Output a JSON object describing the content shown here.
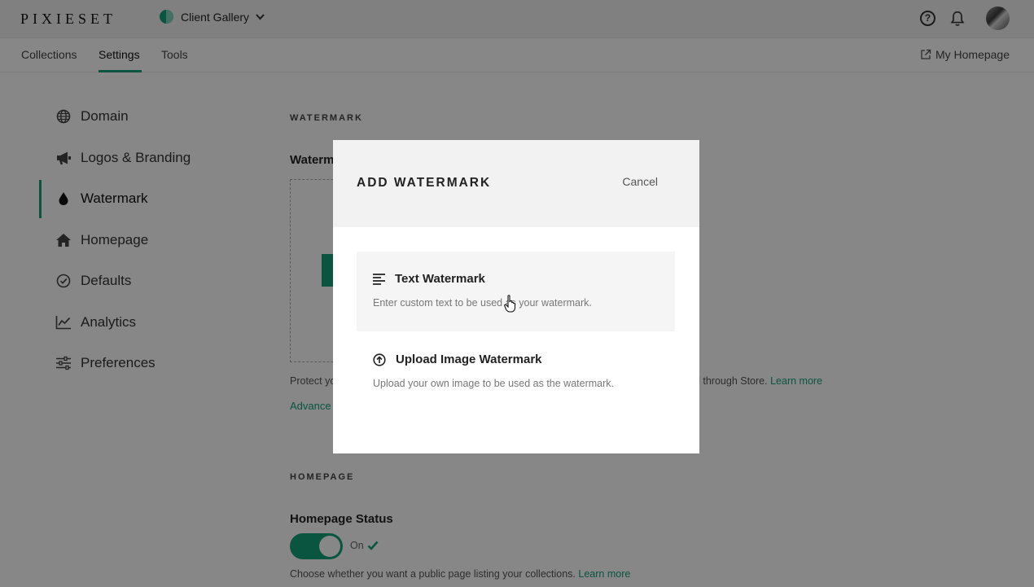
{
  "topbar": {
    "logo": "PIXIESET",
    "gallery_label": "Client Gallery",
    "help_label": "?"
  },
  "subnav": {
    "tabs": [
      {
        "label": "Collections"
      },
      {
        "label": "Settings",
        "active": true
      },
      {
        "label": "Tools"
      }
    ],
    "my_homepage": "My Homepage"
  },
  "sidebar": {
    "items": [
      {
        "label": "Domain",
        "icon": "globe-icon"
      },
      {
        "label": "Logos & Branding",
        "icon": "megaphone-icon"
      },
      {
        "label": "Watermark",
        "icon": "droplet-icon",
        "active": true
      },
      {
        "label": "Homepage",
        "icon": "home-icon"
      },
      {
        "label": "Defaults",
        "icon": "check-circle-icon"
      },
      {
        "label": "Analytics",
        "icon": "line-chart-icon"
      },
      {
        "label": "Preferences",
        "icon": "sliders-icon"
      }
    ]
  },
  "content": {
    "watermark_heading": "WATERMARK",
    "watermark_field_title": "Waterm",
    "protect_text_start": "Protect yo",
    "protect_text_end": "ed through Store.",
    "learn_more": "Learn more",
    "advanced_link": "Advance",
    "homepage_heading": "HOMEPAGE",
    "homepage_status_title": "Homepage Status",
    "toggle_state": "On",
    "choose_text": "Choose whether you want a public page listing your collections.",
    "choose_learn_more": "Learn more"
  },
  "modal": {
    "title": "ADD WATERMARK",
    "cancel_label": "Cancel",
    "options": [
      {
        "title": "Text Watermark",
        "description": "Enter custom text to be used as your watermark.",
        "icon": "text-align-left-icon"
      },
      {
        "title": "Upload Image Watermark",
        "description": "Upload your own image to be used as the watermark.",
        "icon": "upload-circle-icon"
      }
    ]
  },
  "colors": {
    "accent": "#12a07a",
    "overlay": "rgba(0,0,0,0.47)"
  }
}
